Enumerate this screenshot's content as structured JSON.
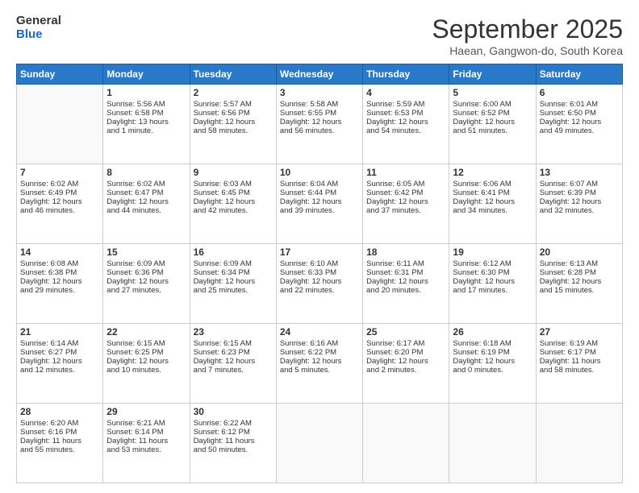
{
  "logo": {
    "line1": "General",
    "line2": "Blue"
  },
  "title": "September 2025",
  "subtitle": "Haean, Gangwon-do, South Korea",
  "days_of_week": [
    "Sunday",
    "Monday",
    "Tuesday",
    "Wednesday",
    "Thursday",
    "Friday",
    "Saturday"
  ],
  "weeks": [
    [
      {
        "day": "",
        "lines": []
      },
      {
        "day": "1",
        "lines": [
          "Sunrise: 5:56 AM",
          "Sunset: 6:58 PM",
          "Daylight: 13 hours",
          "and 1 minute."
        ]
      },
      {
        "day": "2",
        "lines": [
          "Sunrise: 5:57 AM",
          "Sunset: 6:56 PM",
          "Daylight: 12 hours",
          "and 58 minutes."
        ]
      },
      {
        "day": "3",
        "lines": [
          "Sunrise: 5:58 AM",
          "Sunset: 6:55 PM",
          "Daylight: 12 hours",
          "and 56 minutes."
        ]
      },
      {
        "day": "4",
        "lines": [
          "Sunrise: 5:59 AM",
          "Sunset: 6:53 PM",
          "Daylight: 12 hours",
          "and 54 minutes."
        ]
      },
      {
        "day": "5",
        "lines": [
          "Sunrise: 6:00 AM",
          "Sunset: 6:52 PM",
          "Daylight: 12 hours",
          "and 51 minutes."
        ]
      },
      {
        "day": "6",
        "lines": [
          "Sunrise: 6:01 AM",
          "Sunset: 6:50 PM",
          "Daylight: 12 hours",
          "and 49 minutes."
        ]
      }
    ],
    [
      {
        "day": "7",
        "lines": [
          "Sunrise: 6:02 AM",
          "Sunset: 6:49 PM",
          "Daylight: 12 hours",
          "and 46 minutes."
        ]
      },
      {
        "day": "8",
        "lines": [
          "Sunrise: 6:02 AM",
          "Sunset: 6:47 PM",
          "Daylight: 12 hours",
          "and 44 minutes."
        ]
      },
      {
        "day": "9",
        "lines": [
          "Sunrise: 6:03 AM",
          "Sunset: 6:45 PM",
          "Daylight: 12 hours",
          "and 42 minutes."
        ]
      },
      {
        "day": "10",
        "lines": [
          "Sunrise: 6:04 AM",
          "Sunset: 6:44 PM",
          "Daylight: 12 hours",
          "and 39 minutes."
        ]
      },
      {
        "day": "11",
        "lines": [
          "Sunrise: 6:05 AM",
          "Sunset: 6:42 PM",
          "Daylight: 12 hours",
          "and 37 minutes."
        ]
      },
      {
        "day": "12",
        "lines": [
          "Sunrise: 6:06 AM",
          "Sunset: 6:41 PM",
          "Daylight: 12 hours",
          "and 34 minutes."
        ]
      },
      {
        "day": "13",
        "lines": [
          "Sunrise: 6:07 AM",
          "Sunset: 6:39 PM",
          "Daylight: 12 hours",
          "and 32 minutes."
        ]
      }
    ],
    [
      {
        "day": "14",
        "lines": [
          "Sunrise: 6:08 AM",
          "Sunset: 6:38 PM",
          "Daylight: 12 hours",
          "and 29 minutes."
        ]
      },
      {
        "day": "15",
        "lines": [
          "Sunrise: 6:09 AM",
          "Sunset: 6:36 PM",
          "Daylight: 12 hours",
          "and 27 minutes."
        ]
      },
      {
        "day": "16",
        "lines": [
          "Sunrise: 6:09 AM",
          "Sunset: 6:34 PM",
          "Daylight: 12 hours",
          "and 25 minutes."
        ]
      },
      {
        "day": "17",
        "lines": [
          "Sunrise: 6:10 AM",
          "Sunset: 6:33 PM",
          "Daylight: 12 hours",
          "and 22 minutes."
        ]
      },
      {
        "day": "18",
        "lines": [
          "Sunrise: 6:11 AM",
          "Sunset: 6:31 PM",
          "Daylight: 12 hours",
          "and 20 minutes."
        ]
      },
      {
        "day": "19",
        "lines": [
          "Sunrise: 6:12 AM",
          "Sunset: 6:30 PM",
          "Daylight: 12 hours",
          "and 17 minutes."
        ]
      },
      {
        "day": "20",
        "lines": [
          "Sunrise: 6:13 AM",
          "Sunset: 6:28 PM",
          "Daylight: 12 hours",
          "and 15 minutes."
        ]
      }
    ],
    [
      {
        "day": "21",
        "lines": [
          "Sunrise: 6:14 AM",
          "Sunset: 6:27 PM",
          "Daylight: 12 hours",
          "and 12 minutes."
        ]
      },
      {
        "day": "22",
        "lines": [
          "Sunrise: 6:15 AM",
          "Sunset: 6:25 PM",
          "Daylight: 12 hours",
          "and 10 minutes."
        ]
      },
      {
        "day": "23",
        "lines": [
          "Sunrise: 6:15 AM",
          "Sunset: 6:23 PM",
          "Daylight: 12 hours",
          "and 7 minutes."
        ]
      },
      {
        "day": "24",
        "lines": [
          "Sunrise: 6:16 AM",
          "Sunset: 6:22 PM",
          "Daylight: 12 hours",
          "and 5 minutes."
        ]
      },
      {
        "day": "25",
        "lines": [
          "Sunrise: 6:17 AM",
          "Sunset: 6:20 PM",
          "Daylight: 12 hours",
          "and 2 minutes."
        ]
      },
      {
        "day": "26",
        "lines": [
          "Sunrise: 6:18 AM",
          "Sunset: 6:19 PM",
          "Daylight: 12 hours",
          "and 0 minutes."
        ]
      },
      {
        "day": "27",
        "lines": [
          "Sunrise: 6:19 AM",
          "Sunset: 6:17 PM",
          "Daylight: 11 hours",
          "and 58 minutes."
        ]
      }
    ],
    [
      {
        "day": "28",
        "lines": [
          "Sunrise: 6:20 AM",
          "Sunset: 6:16 PM",
          "Daylight: 11 hours",
          "and 55 minutes."
        ]
      },
      {
        "day": "29",
        "lines": [
          "Sunrise: 6:21 AM",
          "Sunset: 6:14 PM",
          "Daylight: 11 hours",
          "and 53 minutes."
        ]
      },
      {
        "day": "30",
        "lines": [
          "Sunrise: 6:22 AM",
          "Sunset: 6:12 PM",
          "Daylight: 11 hours",
          "and 50 minutes."
        ]
      },
      {
        "day": "",
        "lines": []
      },
      {
        "day": "",
        "lines": []
      },
      {
        "day": "",
        "lines": []
      },
      {
        "day": "",
        "lines": []
      }
    ]
  ],
  "colors": {
    "header_bg": "#2a78c9",
    "header_text": "#ffffff",
    "border": "#cccccc",
    "empty_bg": "#f9f9f9"
  }
}
